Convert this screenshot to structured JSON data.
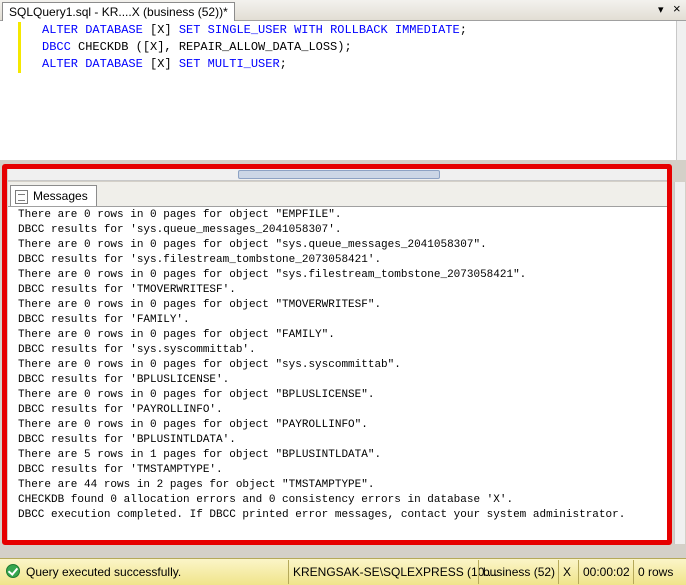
{
  "tab": {
    "title": "SQLQuery1.sql - KR....X (business (52))*"
  },
  "tab_controls": {
    "dropdown_glyph": "▾",
    "close_glyph": "×"
  },
  "editor": {
    "lines": [
      {
        "kw1": "ALTER DATABASE",
        "plain1": " [X] ",
        "kw2": "SET SINGLE_USER WITH ROLLBACK IMMEDIATE",
        "plain2": ";"
      },
      {
        "kw1": "DBCC",
        "plain1": " CHECKDB ([X], REPAIR_ALLOW_DATA_LOSS);",
        "kw2": "",
        "plain2": ""
      },
      {
        "kw1": "ALTER DATABASE",
        "plain1": " [X] ",
        "kw2": "SET MULTI_USER",
        "plain2": ";"
      }
    ]
  },
  "results": {
    "tab_label": "Messages",
    "lines": [
      "There are 0 rows in 0 pages for object \"EMPFILE\".",
      "DBCC results for 'sys.queue_messages_2041058307'.",
      "There are 0 rows in 0 pages for object \"sys.queue_messages_2041058307\".",
      "DBCC results for 'sys.filestream_tombstone_2073058421'.",
      "There are 0 rows in 0 pages for object \"sys.filestream_tombstone_2073058421\".",
      "DBCC results for 'TMOVERWRITESF'.",
      "There are 0 rows in 0 pages for object \"TMOVERWRITESF\".",
      "DBCC results for 'FAMILY'.",
      "There are 0 rows in 0 pages for object \"FAMILY\".",
      "DBCC results for 'sys.syscommittab'.",
      "There are 0 rows in 0 pages for object \"sys.syscommittab\".",
      "DBCC results for 'BPLUSLICENSE'.",
      "There are 0 rows in 0 pages for object \"BPLUSLICENSE\".",
      "DBCC results for 'PAYROLLINFO'.",
      "There are 0 rows in 0 pages for object \"PAYROLLINFO\".",
      "DBCC results for 'BPLUSINTLDATA'.",
      "There are 5 rows in 1 pages for object \"BPLUSINTLDATA\".",
      "DBCC results for 'TMSTAMPTYPE'.",
      "There are 44 rows in 2 pages for object \"TMSTAMPTYPE\".",
      "CHECKDB found 0 allocation errors and 0 consistency errors in database 'X'.",
      "DBCC execution completed. If DBCC printed error messages, contact your system administrator."
    ]
  },
  "status": {
    "message": "Query executed successfully.",
    "server": "KRENGSAK-SE\\SQLEXPRESS (10....",
    "database": "business (52)",
    "user": "X",
    "elapsed": "00:00:02",
    "rows": "0 rows"
  },
  "colors": {
    "keyword": "#0000ff",
    "highlight_frame": "#e60000",
    "status_bar": "#f0e48a",
    "modified_marker": "#f5e800"
  }
}
